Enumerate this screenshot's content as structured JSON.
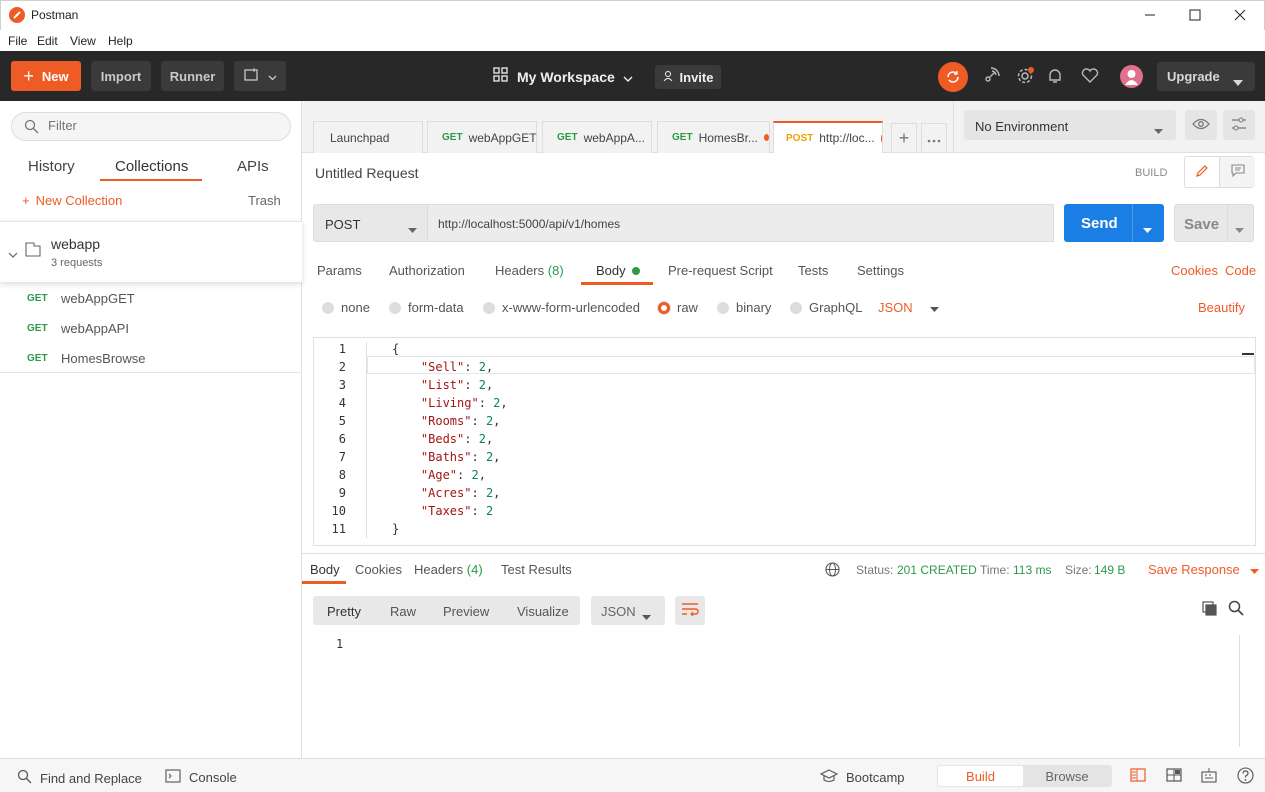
{
  "window": {
    "title": "Postman"
  },
  "menu": [
    "File",
    "Edit",
    "View",
    "Help"
  ],
  "header": {
    "new_label": "New",
    "import_label": "Import",
    "runner_label": "Runner",
    "workspace_label": "My Workspace",
    "invite_label": "Invite",
    "upgrade_label": "Upgrade",
    "accent": "#ef5b25"
  },
  "sidebar": {
    "filter_placeholder": "Filter",
    "tabs": [
      "History",
      "Collections",
      "APIs"
    ],
    "new_collection_label": "New Collection",
    "trash_label": "Trash",
    "collection": {
      "name": "webapp",
      "count": "3 requests"
    },
    "requests": [
      {
        "method": "GET",
        "name": "webAppGET"
      },
      {
        "method": "GET",
        "name": "webAppAPI"
      },
      {
        "method": "GET",
        "name": "HomesBrowse"
      }
    ]
  },
  "tabs": [
    {
      "method": "",
      "label": "Launchpad"
    },
    {
      "method": "GET",
      "label": "webAppGET"
    },
    {
      "method": "GET",
      "label": "webAppA..."
    },
    {
      "method": "GET",
      "label": "HomesBr..."
    },
    {
      "method": "POST",
      "label": "http://loc..."
    }
  ],
  "environment": {
    "selected": "No Environment"
  },
  "request": {
    "title": "Untitled Request",
    "build_label": "BUILD",
    "method": "POST",
    "url": "http://localhost:5000/api/v1/homes",
    "send_label": "Send",
    "save_label": "Save",
    "subtabs": {
      "params": "Params",
      "authorization": "Authorization",
      "headers": "Headers",
      "headers_count": "(8)",
      "body": "Body",
      "prerequest": "Pre-request Script",
      "tests": "Tests",
      "settings": "Settings"
    },
    "cookies_label": "Cookies",
    "code_label": "Code",
    "body_types": [
      "none",
      "form-data",
      "x-www-form-urlencoded",
      "raw",
      "binary",
      "GraphQL"
    ],
    "body_selected": "raw",
    "format": "JSON",
    "beautify_label": "Beautify",
    "body_lines": [
      "{",
      "    \"Sell\": 2,",
      "    \"List\": 2,",
      "    \"Living\": 2,",
      "    \"Rooms\": 2,",
      "    \"Beds\": 2,",
      "    \"Baths\": 2,",
      "    \"Age\": 2,",
      "    \"Acres\": 2,",
      "    \"Taxes\": 2",
      "}"
    ]
  },
  "response": {
    "tabs": {
      "body": "Body",
      "cookies": "Cookies",
      "headers": "Headers",
      "headers_count": "(4)",
      "tests": "Test Results"
    },
    "status_label": "Status:",
    "status_value": "201 CREATED",
    "time_label": "Time:",
    "time_value": "113 ms",
    "size_label": "Size:",
    "size_value": "149 B",
    "save_response_label": "Save Response",
    "views": [
      "Pretty",
      "Raw",
      "Preview",
      "Visualize"
    ],
    "format": "JSON",
    "line_number": "1"
  },
  "statusbar": {
    "find_label": "Find and Replace",
    "console_label": "Console",
    "bootcamp_label": "Bootcamp",
    "build_label": "Build",
    "browse_label": "Browse"
  }
}
